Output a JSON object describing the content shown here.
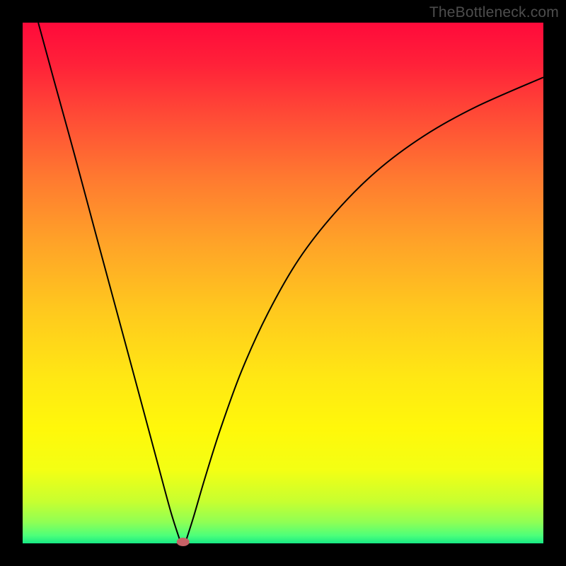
{
  "watermark": "TheBottleneck.com",
  "chart_data": {
    "type": "line",
    "title": "",
    "xlabel": "",
    "ylabel": "",
    "xlim": [
      0,
      100
    ],
    "ylim": [
      0,
      100
    ],
    "gradient": [
      {
        "stop": 0.0,
        "color": "#ff0a3a"
      },
      {
        "stop": 0.08,
        "color": "#ff2139"
      },
      {
        "stop": 0.18,
        "color": "#ff4b36"
      },
      {
        "stop": 0.3,
        "color": "#ff7a30"
      },
      {
        "stop": 0.42,
        "color": "#ffa228"
      },
      {
        "stop": 0.55,
        "color": "#ffc81e"
      },
      {
        "stop": 0.68,
        "color": "#ffe714"
      },
      {
        "stop": 0.78,
        "color": "#fff80a"
      },
      {
        "stop": 0.86,
        "color": "#f3ff14"
      },
      {
        "stop": 0.92,
        "color": "#c7ff30"
      },
      {
        "stop": 0.96,
        "color": "#8eff55"
      },
      {
        "stop": 0.985,
        "color": "#4dff7a"
      },
      {
        "stop": 1.0,
        "color": "#17e884"
      }
    ],
    "series": [
      {
        "name": "left-branch",
        "x": [
          3.0,
          6.0,
          10.0,
          14.0,
          18.0,
          22.0,
          26.0,
          28.5,
          30.3
        ],
        "values": [
          100.0,
          89.0,
          74.5,
          59.6,
          44.8,
          30.0,
          15.1,
          5.9,
          0.3
        ]
      },
      {
        "name": "right-branch",
        "x": [
          31.3,
          32.8,
          35.0,
          38.0,
          42.0,
          47.0,
          53.0,
          60.0,
          68.0,
          77.0,
          87.0,
          100.0
        ],
        "values": [
          0.3,
          5.0,
          12.5,
          22.0,
          33.0,
          44.0,
          54.5,
          63.5,
          71.5,
          78.2,
          83.8,
          89.5
        ]
      }
    ],
    "marker": {
      "x": 30.8,
      "y": 0.0
    }
  }
}
